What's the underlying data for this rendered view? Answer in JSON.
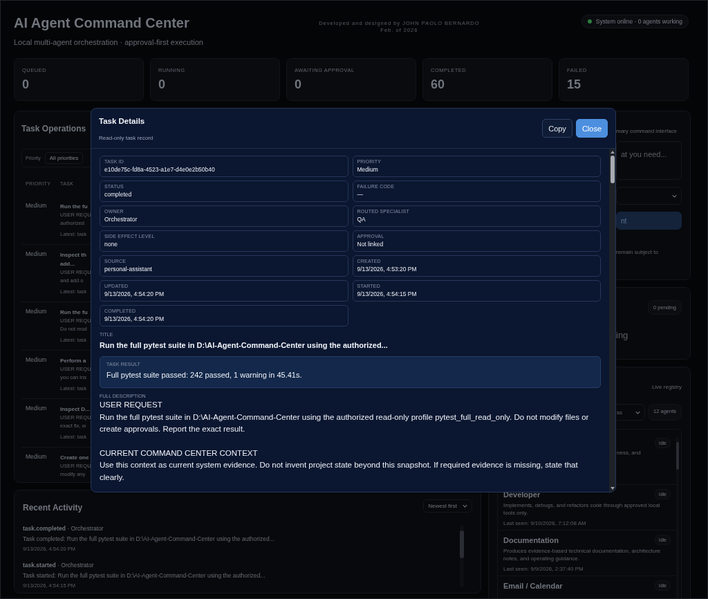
{
  "header": {
    "title": "AI Agent Command Center",
    "subtitle": "Local multi-agent orchestration · approval-first execution",
    "credit": [
      "Developed and designed by JOHN PAOLO BERNARDO",
      "Feb. of 2026"
    ],
    "status": {
      "text": "System online · 0 agents working",
      "online": true
    }
  },
  "stats": [
    {
      "label": "QUEUED",
      "value": "0"
    },
    {
      "label": "RUNNING",
      "value": "0"
    },
    {
      "label": "AWAITING APPROVAL",
      "value": "0"
    },
    {
      "label": "COMPLETED",
      "value": "60"
    },
    {
      "label": "FAILED",
      "value": "15"
    }
  ],
  "task_operations": {
    "title": "Task Operations",
    "filter": {
      "label": "Priority",
      "value": "All priorities"
    },
    "columns": [
      "PRIORITY",
      "TASK"
    ],
    "rows": [
      {
        "priority": "Medium",
        "title_lines": [
          "Run the fu"
        ],
        "desc_lines": [
          "USER REQU",
          "authorized"
        ],
        "latest": "Latest: task"
      },
      {
        "priority": "Medium",
        "title_lines": [
          "Inspect th",
          "add..."
        ],
        "desc_lines": [
          "USER REQU",
          "and add o"
        ],
        "latest": "Latest: task"
      },
      {
        "priority": "Medium",
        "title_lines": [
          "Run the fu"
        ],
        "desc_lines": [
          "USER REQU",
          "Do not mod"
        ],
        "latest": "Latest: task"
      },
      {
        "priority": "Medium",
        "title_lines": [
          "Perform a"
        ],
        "desc_lines": [
          "USER REQU",
          "you can ins"
        ],
        "latest": "Latest: task"
      },
      {
        "priority": "Medium",
        "title_lines": [
          "Inspect D..."
        ],
        "desc_lines": [
          "USER REQU",
          "exact fix, w"
        ],
        "latest": "Latest: task"
      },
      {
        "priority": "Medium",
        "title_lines": [
          "Create one"
        ],
        "desc_lines": [
          "USER REQU",
          "modify any"
        ]
      }
    ]
  },
  "recent_activity": {
    "title": "Recent Activity",
    "sort": "Newest first",
    "events": [
      {
        "line": "**task.completed** · Orchestrator",
        "text": "Task completed: Run the full pytest suite in D:\\AI-Agent-Command-Center using the authorized...",
        "time": "9/13/2026, 4:54:20 PM"
      },
      {
        "line": "**task.started** · Orchestrator",
        "text": "Task started: Run the full pytest suite in D:\\AI-Agent-Command-Center using the authorized...",
        "time": "9/13/2026, 4:54:15 PM"
      }
    ]
  },
  "command_panel": {
    "subtitle": "mary command interface",
    "placeholder": "at you need...",
    "button": "nt",
    "note": "remain subject to"
  },
  "approvals_panel": {
    "badge": "0 pending",
    "empty": "ing"
  },
  "agents_panel": {
    "badge": "Live registry",
    "filter": "ss",
    "count": "12 agents",
    "agents": [
      {
        "status": "idle",
        "desc": "ness, and"
      },
      {
        "name": "Developer",
        "status": "idle",
        "desc": "Implements, debugs, and refactors code through approved local tools only.",
        "last_seen": "Last seen: 9/10/2026, 7:12:08 AM"
      },
      {
        "name": "Documentation",
        "status": "idle",
        "desc": "Produces evidence-based technical documentation, architecture notes, and operating guidance.",
        "last_seen": "Last seen: 9/9/2026, 2:37:40 PM"
      },
      {
        "name": "Email / Calendar",
        "status": "idle"
      }
    ]
  },
  "modal": {
    "title": "Task Details",
    "subtitle": "Read-only task record",
    "buttons": [
      {
        "label": "Copy",
        "primary": false
      },
      {
        "label": "Close",
        "primary": true
      }
    ],
    "fields": [
      {
        "label": "TASK ID",
        "value": "e10de75c-fd8a-4523-a1e7-d4e0e2b50b40"
      },
      {
        "label": "PRIORITY",
        "value": "Medium"
      },
      {
        "label": "STATUS",
        "value": "completed"
      },
      {
        "label": "FAILURE CODE",
        "value": "—"
      },
      {
        "label": "OWNER",
        "value": "Orchestrator"
      },
      {
        "label": "ROUTED SPECIALIST",
        "value": "QA"
      },
      {
        "label": "SIDE EFFECT LEVEL",
        "value": "none"
      },
      {
        "label": "APPROVAL",
        "value": "Not linked"
      },
      {
        "label": "SOURCE",
        "value": "personal-assistant"
      },
      {
        "label": "CREATED",
        "value": "9/13/2026, 4:53:20 PM"
      },
      {
        "label": "UPDATED",
        "value": "9/13/2026, 4:54:20 PM"
      },
      {
        "label": "STARTED",
        "value": "9/13/2026, 4:54:15 PM"
      },
      {
        "label": "COMPLETED",
        "value": "9/13/2026, 4:54:20 PM"
      }
    ],
    "title_label": "TITLE",
    "task_title": "Run the full pytest suite in D:\\AI-Agent-Command-Center using the authorized...",
    "result": {
      "label": "TASK RESULT",
      "text": "Full pytest suite passed: 242 passed, 1 warning in 45.41s."
    },
    "description_label": "FULL DESCRIPTION",
    "description": [
      {
        "heading": "USER REQUEST",
        "text": "Run the full pytest suite in D:\\AI-Agent-Command-Center using the authorized read-only profile pytest_full_read_only. Do not modify files or create approvals. Report the exact result."
      },
      {
        "heading": "CURRENT COMMAND CENTER CONTEXT",
        "text": "Use this context as current system evidence. Do not invent project state beyond this snapshot. If required evidence is missing, state that clearly."
      }
    ]
  }
}
